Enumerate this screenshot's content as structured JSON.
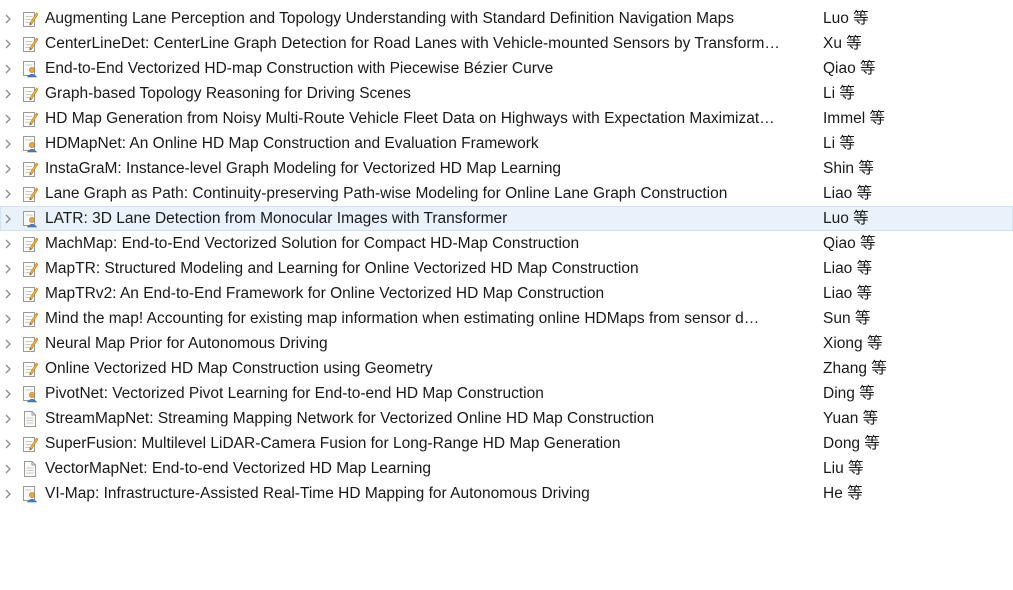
{
  "rows": [
    {
      "title": "Augmenting Lane Perception and Topology Understanding with Standard Definition Navigation Maps",
      "author": "Luo 等",
      "icon": "note-icon"
    },
    {
      "title": "CenterLineDet: CenterLine Graph Detection for Road Lanes with Vehicle-mounted Sensors by Transform…",
      "author": "Xu 等",
      "icon": "note-icon"
    },
    {
      "title": "End-to-End Vectorized HD-map Construction with Piecewise Bézier Curve",
      "author": "Qiao 等",
      "icon": "user-doc-icon"
    },
    {
      "title": "Graph-based Topology Reasoning for Driving Scenes",
      "author": "Li 等",
      "icon": "note-icon"
    },
    {
      "title": "HD Map Generation from Noisy Multi-Route Vehicle Fleet Data on Highways with Expectation Maximizat…",
      "author": "Immel 等",
      "icon": "note-icon"
    },
    {
      "title": "HDMapNet: An Online HD Map Construction and Evaluation Framework",
      "author": "Li 等",
      "icon": "user-doc-icon"
    },
    {
      "title": "InstaGraM: Instance-level Graph Modeling for Vectorized HD Map Learning",
      "author": "Shin 等",
      "icon": "note-icon"
    },
    {
      "title": "Lane Graph as Path: Continuity-preserving Path-wise Modeling for Online Lane Graph Construction",
      "author": "Liao 等",
      "icon": "note-icon"
    },
    {
      "title": "LATR: 3D Lane Detection from Monocular Images with Transformer",
      "author": "Luo 等",
      "icon": "user-doc-icon",
      "selected": true
    },
    {
      "title": "MachMap: End-to-End Vectorized Solution for Compact HD-Map Construction",
      "author": "Qiao 等",
      "icon": "note-icon"
    },
    {
      "title": "MapTR: Structured Modeling and Learning for Online Vectorized HD Map Construction",
      "author": "Liao 等",
      "icon": "note-icon"
    },
    {
      "title": "MapTRv2: An End-to-End Framework for Online Vectorized HD Map Construction",
      "author": "Liao 等",
      "icon": "note-icon"
    },
    {
      "title": "Mind the map! Accounting for existing map information when estimating online HDMaps from sensor d…",
      "author": "Sun 等",
      "icon": "note-icon"
    },
    {
      "title": "Neural Map Prior for Autonomous Driving",
      "author": "Xiong 等",
      "icon": "note-icon"
    },
    {
      "title": "Online Vectorized HD Map Construction using Geometry",
      "author": "Zhang 等",
      "icon": "note-icon"
    },
    {
      "title": "PivotNet: Vectorized Pivot Learning for End-to-end HD Map Construction",
      "author": "Ding 等",
      "icon": "user-doc-icon"
    },
    {
      "title": "StreamMapNet: Streaming Mapping Network for Vectorized Online HD Map Construction",
      "author": "Yuan 等",
      "icon": "document-icon"
    },
    {
      "title": "SuperFusion: Multilevel LiDAR-Camera Fusion for Long-Range HD Map Generation",
      "author": "Dong 等",
      "icon": "note-icon"
    },
    {
      "title": "VectorMapNet: End-to-end Vectorized HD Map Learning",
      "author": "Liu 等",
      "icon": "document-icon"
    },
    {
      "title": "VI-Map: Infrastructure-Assisted Real-Time HD Mapping for Autonomous Driving",
      "author": "He 等",
      "icon": "user-doc-icon"
    }
  ],
  "colors": {
    "selected_bg": "#e9f2fb",
    "selected_border": "#cfe3f6",
    "text": "#1a1a1a",
    "chevron": "#8c8c8c"
  }
}
